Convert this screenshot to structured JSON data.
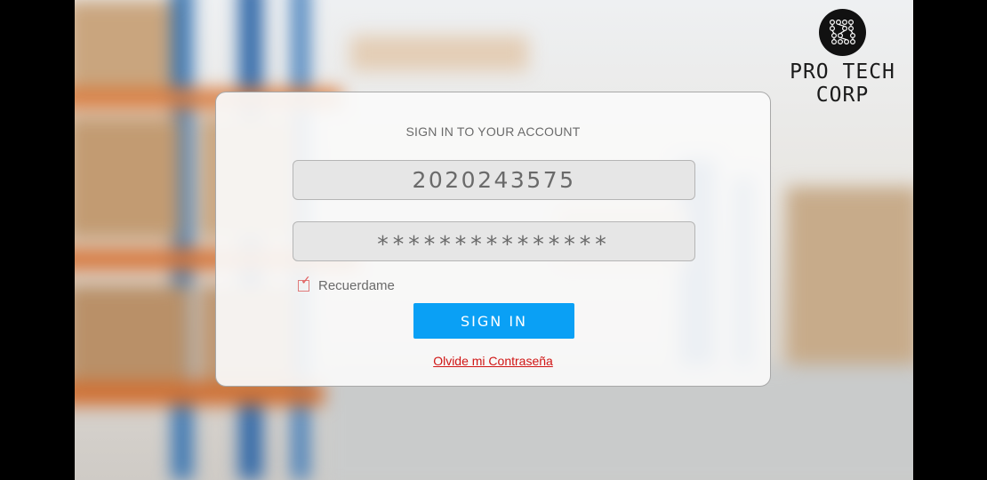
{
  "brand": {
    "logo_icon": "circuit-logo-icon",
    "name_line1": "PRO TECH",
    "name_line2": "CORP"
  },
  "login": {
    "title": "SIGN IN TO YOUR ACCOUNT",
    "username_value": "2020243575",
    "password_value": "***************",
    "remember_label": "Recuerdame",
    "remember_checked": true,
    "sign_in_label": "SIGN IN",
    "forgot_label": "Olvide mi Contraseña"
  },
  "colors": {
    "button": "#0aa0f5",
    "link": "#d01414"
  }
}
